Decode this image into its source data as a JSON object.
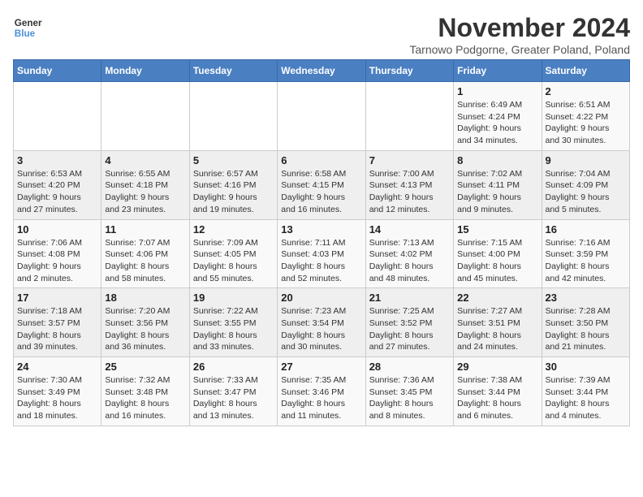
{
  "logo": {
    "line1": "General",
    "line2": "Blue"
  },
  "title": "November 2024",
  "subtitle": "Tarnowo Podgorne, Greater Poland, Poland",
  "weekdays": [
    "Sunday",
    "Monday",
    "Tuesday",
    "Wednesday",
    "Thursday",
    "Friday",
    "Saturday"
  ],
  "weeks": [
    [
      {
        "day": "",
        "info": ""
      },
      {
        "day": "",
        "info": ""
      },
      {
        "day": "",
        "info": ""
      },
      {
        "day": "",
        "info": ""
      },
      {
        "day": "",
        "info": ""
      },
      {
        "day": "1",
        "info": "Sunrise: 6:49 AM\nSunset: 4:24 PM\nDaylight: 9 hours\nand 34 minutes."
      },
      {
        "day": "2",
        "info": "Sunrise: 6:51 AM\nSunset: 4:22 PM\nDaylight: 9 hours\nand 30 minutes."
      }
    ],
    [
      {
        "day": "3",
        "info": "Sunrise: 6:53 AM\nSunset: 4:20 PM\nDaylight: 9 hours\nand 27 minutes."
      },
      {
        "day": "4",
        "info": "Sunrise: 6:55 AM\nSunset: 4:18 PM\nDaylight: 9 hours\nand 23 minutes."
      },
      {
        "day": "5",
        "info": "Sunrise: 6:57 AM\nSunset: 4:16 PM\nDaylight: 9 hours\nand 19 minutes."
      },
      {
        "day": "6",
        "info": "Sunrise: 6:58 AM\nSunset: 4:15 PM\nDaylight: 9 hours\nand 16 minutes."
      },
      {
        "day": "7",
        "info": "Sunrise: 7:00 AM\nSunset: 4:13 PM\nDaylight: 9 hours\nand 12 minutes."
      },
      {
        "day": "8",
        "info": "Sunrise: 7:02 AM\nSunset: 4:11 PM\nDaylight: 9 hours\nand 9 minutes."
      },
      {
        "day": "9",
        "info": "Sunrise: 7:04 AM\nSunset: 4:09 PM\nDaylight: 9 hours\nand 5 minutes."
      }
    ],
    [
      {
        "day": "10",
        "info": "Sunrise: 7:06 AM\nSunset: 4:08 PM\nDaylight: 9 hours\nand 2 minutes."
      },
      {
        "day": "11",
        "info": "Sunrise: 7:07 AM\nSunset: 4:06 PM\nDaylight: 8 hours\nand 58 minutes."
      },
      {
        "day": "12",
        "info": "Sunrise: 7:09 AM\nSunset: 4:05 PM\nDaylight: 8 hours\nand 55 minutes."
      },
      {
        "day": "13",
        "info": "Sunrise: 7:11 AM\nSunset: 4:03 PM\nDaylight: 8 hours\nand 52 minutes."
      },
      {
        "day": "14",
        "info": "Sunrise: 7:13 AM\nSunset: 4:02 PM\nDaylight: 8 hours\nand 48 minutes."
      },
      {
        "day": "15",
        "info": "Sunrise: 7:15 AM\nSunset: 4:00 PM\nDaylight: 8 hours\nand 45 minutes."
      },
      {
        "day": "16",
        "info": "Sunrise: 7:16 AM\nSunset: 3:59 PM\nDaylight: 8 hours\nand 42 minutes."
      }
    ],
    [
      {
        "day": "17",
        "info": "Sunrise: 7:18 AM\nSunset: 3:57 PM\nDaylight: 8 hours\nand 39 minutes."
      },
      {
        "day": "18",
        "info": "Sunrise: 7:20 AM\nSunset: 3:56 PM\nDaylight: 8 hours\nand 36 minutes."
      },
      {
        "day": "19",
        "info": "Sunrise: 7:22 AM\nSunset: 3:55 PM\nDaylight: 8 hours\nand 33 minutes."
      },
      {
        "day": "20",
        "info": "Sunrise: 7:23 AM\nSunset: 3:54 PM\nDaylight: 8 hours\nand 30 minutes."
      },
      {
        "day": "21",
        "info": "Sunrise: 7:25 AM\nSunset: 3:52 PM\nDaylight: 8 hours\nand 27 minutes."
      },
      {
        "day": "22",
        "info": "Sunrise: 7:27 AM\nSunset: 3:51 PM\nDaylight: 8 hours\nand 24 minutes."
      },
      {
        "day": "23",
        "info": "Sunrise: 7:28 AM\nSunset: 3:50 PM\nDaylight: 8 hours\nand 21 minutes."
      }
    ],
    [
      {
        "day": "24",
        "info": "Sunrise: 7:30 AM\nSunset: 3:49 PM\nDaylight: 8 hours\nand 18 minutes."
      },
      {
        "day": "25",
        "info": "Sunrise: 7:32 AM\nSunset: 3:48 PM\nDaylight: 8 hours\nand 16 minutes."
      },
      {
        "day": "26",
        "info": "Sunrise: 7:33 AM\nSunset: 3:47 PM\nDaylight: 8 hours\nand 13 minutes."
      },
      {
        "day": "27",
        "info": "Sunrise: 7:35 AM\nSunset: 3:46 PM\nDaylight: 8 hours\nand 11 minutes."
      },
      {
        "day": "28",
        "info": "Sunrise: 7:36 AM\nSunset: 3:45 PM\nDaylight: 8 hours\nand 8 minutes."
      },
      {
        "day": "29",
        "info": "Sunrise: 7:38 AM\nSunset: 3:44 PM\nDaylight: 8 hours\nand 6 minutes."
      },
      {
        "day": "30",
        "info": "Sunrise: 7:39 AM\nSunset: 3:44 PM\nDaylight: 8 hours\nand 4 minutes."
      }
    ]
  ]
}
